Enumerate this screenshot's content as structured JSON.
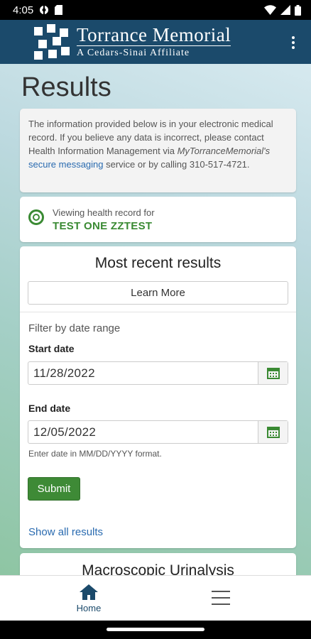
{
  "status_bar": {
    "time": "4:05"
  },
  "app_bar": {
    "brand_line1": "Torrance Memorial",
    "brand_line2": "A Cedars-Sinai Affiliate"
  },
  "page": {
    "title": "Results"
  },
  "info": {
    "text_before": "The information provided below is in your electronic medical record. If you believe any data is incorrect, please contact Health Information Management via ",
    "app_name": "MyTorranceMemorial's",
    "link": "secure messaging",
    "text_after": " service or by calling 310-517-4721."
  },
  "record": {
    "label": "Viewing health record for",
    "patient_name": "TEST ONE ZZTEST"
  },
  "results": {
    "title": "Most recent results",
    "learn_more": "Learn More",
    "filter_label": "Filter by date range",
    "start_label": "Start date",
    "start_value": "11/28/2022",
    "end_label": "End date",
    "end_value": "12/05/2022",
    "hint": "Enter date in MM/DD/YYYY format.",
    "submit": "Submit",
    "show_all": "Show all results"
  },
  "next_card": {
    "title": "Macroscopic Urinalysis"
  },
  "bottom_nav": {
    "home_label": "Home"
  },
  "colors": {
    "brand": "#1b4a6b",
    "accent_green": "#3a8a33",
    "link": "#2a6bb0"
  }
}
